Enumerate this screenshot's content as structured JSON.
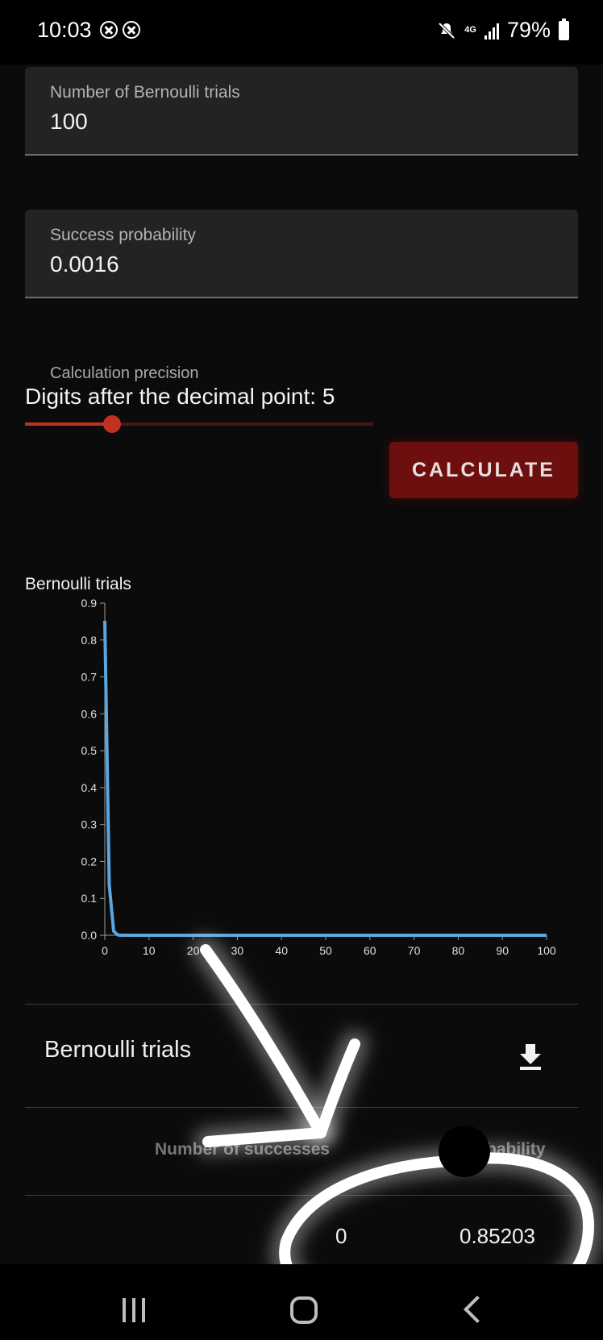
{
  "status_bar": {
    "time": "10:03",
    "network": "4G",
    "battery": "79%"
  },
  "form": {
    "trials": {
      "label": "Number of Bernoulli trials",
      "value": "100"
    },
    "probability": {
      "label": "Success probability",
      "value": "0.0016"
    },
    "precision": {
      "label": "Calculation precision",
      "digits_text": "Digits after the decimal point: 5",
      "value": 5,
      "min": 0,
      "max": 20
    },
    "calculate_label": "CALCULATE",
    "accent_color": "#c0321e",
    "button_color": "#6e0f0f"
  },
  "chart_data": {
    "type": "line",
    "title": "Bernoulli trials",
    "xlim": [
      0,
      100
    ],
    "ylim": [
      0,
      0.9
    ],
    "x_ticks": [
      0,
      10,
      20,
      30,
      40,
      50,
      60,
      70,
      80,
      90,
      100
    ],
    "y_ticks": [
      "0.0",
      "0.1",
      "0.2",
      "0.3",
      "0.4",
      "0.5",
      "0.6",
      "0.7",
      "0.8",
      "0.9"
    ],
    "line_color": "#5aa6e0",
    "series": [
      {
        "x": [
          0,
          1,
          2,
          3,
          4,
          5,
          10,
          20,
          30,
          40,
          50,
          60,
          70,
          80,
          90,
          100
        ],
        "y": [
          0.85203,
          0.13653,
          0.01083,
          0.00057,
          2e-05,
          0,
          0,
          0,
          0,
          0,
          0,
          0,
          0,
          0,
          0,
          0
        ]
      }
    ]
  },
  "table": {
    "title": "Bernoulli trials",
    "columns": [
      "Number of successes",
      "Probability"
    ],
    "rows": [
      [
        "0",
        "0.85203"
      ]
    ]
  }
}
